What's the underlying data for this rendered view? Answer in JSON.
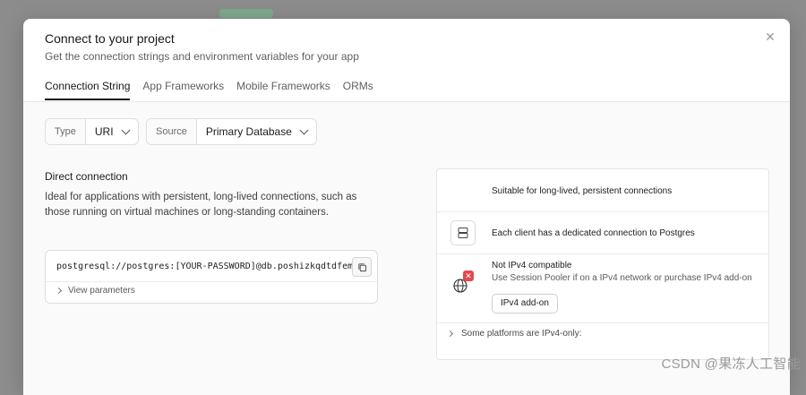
{
  "modal": {
    "title": "Connect to your project",
    "subtitle": "Get the connection strings and environment variables for your app"
  },
  "tabs": [
    {
      "label": "Connection String",
      "active": true
    },
    {
      "label": "App Frameworks",
      "active": false
    },
    {
      "label": "Mobile Frameworks",
      "active": false
    },
    {
      "label": "ORMs",
      "active": false
    }
  ],
  "selectors": {
    "type": {
      "label": "Type",
      "value": "URI"
    },
    "source": {
      "label": "Source",
      "value": "Primary Database"
    }
  },
  "direct": {
    "title": "Direct connection",
    "description": "Ideal for applications with persistent, long-lived connections, such as those running on virtual machines or long-standing containers.",
    "connection_string": "postgresql://postgres:[YOUR-PASSWORD]@db.poshizkqdtdfemu",
    "view_parameters": "View parameters"
  },
  "features": {
    "suitable": "Suitable for long-lived, persistent connections",
    "dedicated": "Each client has a dedicated connection to Postgres",
    "ipv4_title": "Not IPv4 compatible",
    "ipv4_desc": "Use Session Pooler if on a IPv4 network or purchase IPv4 add-on",
    "addon_button": "IPv4 add-on",
    "footer": "Some platforms are IPv4-only:"
  },
  "icons": {
    "close": "close-icon",
    "copy": "copy-icon",
    "server": "server-icon",
    "globe": "globe-icon",
    "error_badge": "x-badge-icon"
  },
  "colors": {
    "error": "#e5484d",
    "text": "#1c1c1c",
    "muted": "#5f5f5f"
  },
  "watermark": "CSDN @果冻人工智能"
}
